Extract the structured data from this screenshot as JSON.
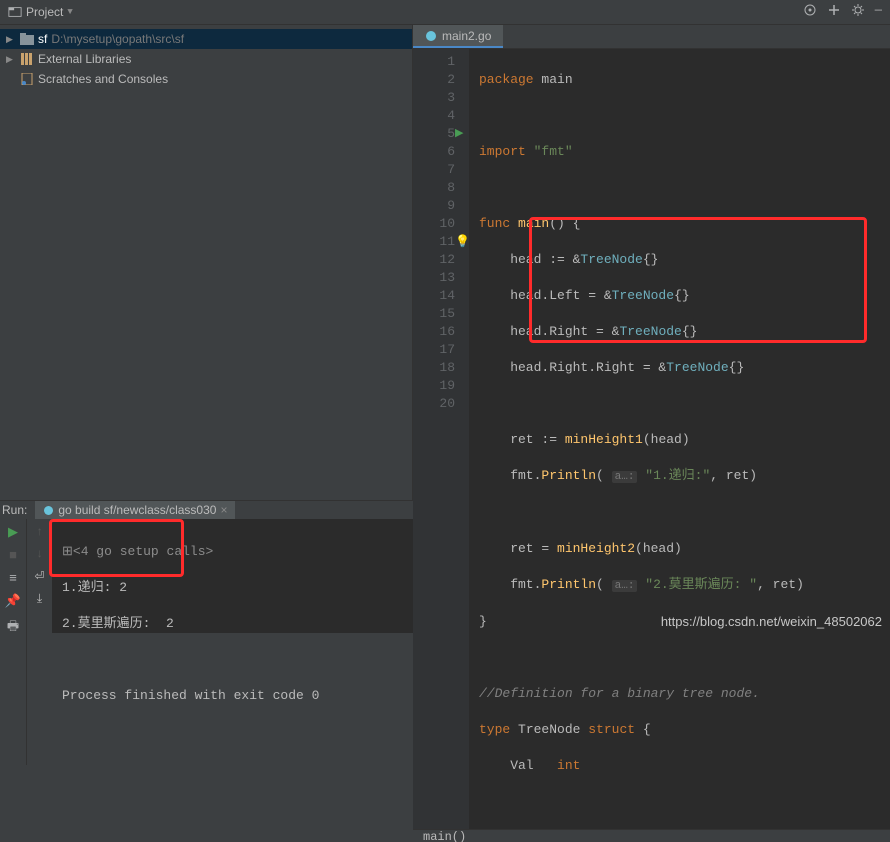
{
  "toolbar": {
    "project_label": "Project"
  },
  "tree": {
    "root_name": "sf",
    "root_path": "D:\\mysetup\\gopath\\src\\sf",
    "ext_lib": "External Libraries",
    "scratches": "Scratches and Consoles"
  },
  "tab": {
    "name": "main2.go"
  },
  "gutter": {
    "lines": [
      "1",
      "2",
      "3",
      "4",
      "5",
      "6",
      "7",
      "8",
      "9",
      "10",
      "11",
      "12",
      "13",
      "14",
      "15",
      "16",
      "17",
      "18",
      "19",
      "20"
    ]
  },
  "code": {
    "l1_k": "package",
    "l1_id": "main",
    "l3_k": "import",
    "l3_s": "\"fmt\"",
    "l5_k": "func",
    "l5_fn": "main",
    "l5_tail": "() {",
    "l6": "    head := &",
    "l6_t": "TreeNode",
    "l6_tail": "{}",
    "l7": "    head.Left = &",
    "l7_t": "TreeNode",
    "l7_tail": "{}",
    "l8": "    head.Right = &",
    "l8_t": "TreeNode",
    "l8_tail": "{}",
    "l9": "    head.Right.Right = &",
    "l9_t": "TreeNode",
    "l9_tail": "{}",
    "l11": "    ret := ",
    "l11_fn": "minHeight1",
    "l11_tail": "(head)",
    "l12": "    fmt.",
    "l12_fn": "Println",
    "l12_open": "( ",
    "l12_hint": "a…:",
    "l12_s": "\"1.递归:\"",
    "l12_tail": ", ret)",
    "l14": "    ret = ",
    "l14_fn": "minHeight2",
    "l14_tail": "(head)",
    "l15": "    fmt.",
    "l15_fn": "Println",
    "l15_open": "( ",
    "l15_hint": "a…:",
    "l15_s": "\"2.莫里斯遍历: \"",
    "l15_tail": ", ret)",
    "l16": "}",
    "l18_cmt": "//Definition for a binary tree node.",
    "l19_k1": "type",
    "l19_id": "TreeNode",
    "l19_k2": "struct",
    "l19_tail": " {",
    "l20": "    Val   ",
    "l20_t": "int"
  },
  "breadcrumb": "main()",
  "run": {
    "label": "Run:",
    "config": "go build sf/newclass/class030",
    "out1": "<4 go setup calls>",
    "out2": "1.递归: 2",
    "out3": "2.莫里斯遍历:  2",
    "out4": "Process finished with exit code 0"
  },
  "watermark": "https://blog.csdn.net/weixin_48502062"
}
